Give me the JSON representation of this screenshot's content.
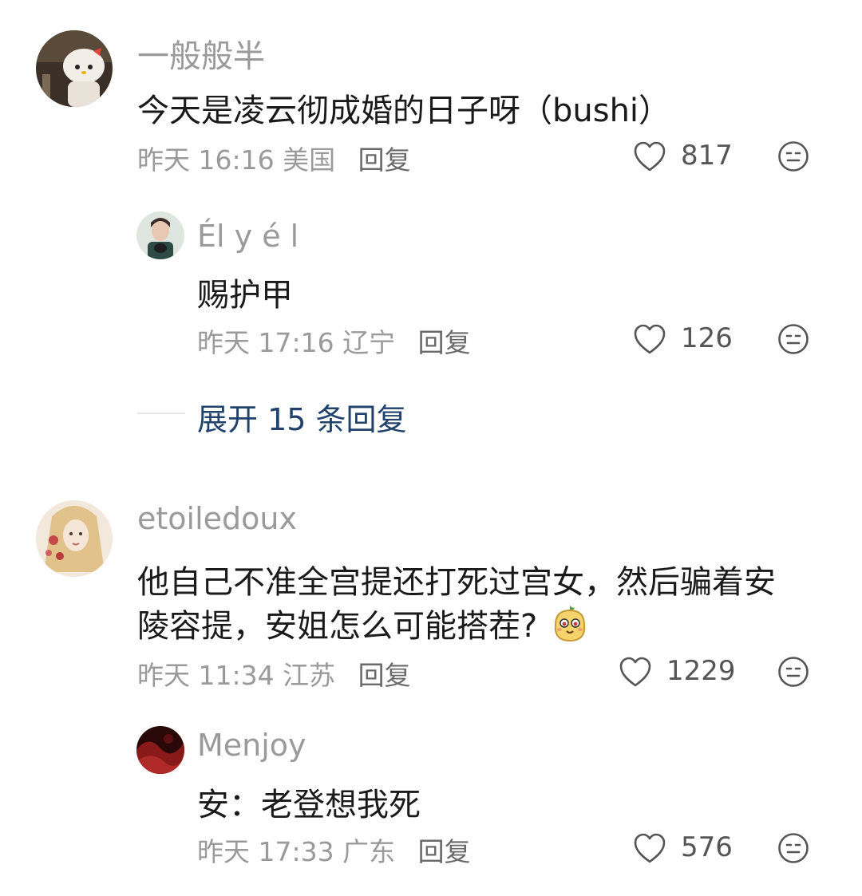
{
  "comments": [
    {
      "username": "一般般半",
      "content": "今天是凌云彻成婚的日子呀（bushi）",
      "time": "昨天 16:16",
      "location": "美国",
      "reply_label": "回复",
      "likes": "817",
      "replies": [
        {
          "username": "Él y é l",
          "content": "赐护甲",
          "time": "昨天 17:16",
          "location": "辽宁",
          "reply_label": "回复",
          "likes": "126"
        }
      ],
      "expand_label": "展开 15 条回复"
    },
    {
      "username": "etoiledoux",
      "content_line1": "他自己不准全宫提还打死过宫女，然后骗着安",
      "content_line2": "陵容提，安姐怎么可能搭茬?",
      "time": "昨天 11:34",
      "location": "江苏",
      "reply_label": "回复",
      "likes": "1229",
      "replies": [
        {
          "username": "Menjoy",
          "content": "安：老登想我死",
          "time": "昨天 17:33",
          "location": "广东",
          "reply_label": "回复",
          "likes": "576"
        }
      ]
    }
  ],
  "icons": {
    "like": "heart-outline-icon",
    "dislike": "neutral-face-icon",
    "emoji": "mango-sticker-emoji"
  },
  "colors": {
    "username": "#9a9a9a",
    "content": "#1a1a1a",
    "meta": "#9a9a9a",
    "expand_link": "#20426b"
  }
}
